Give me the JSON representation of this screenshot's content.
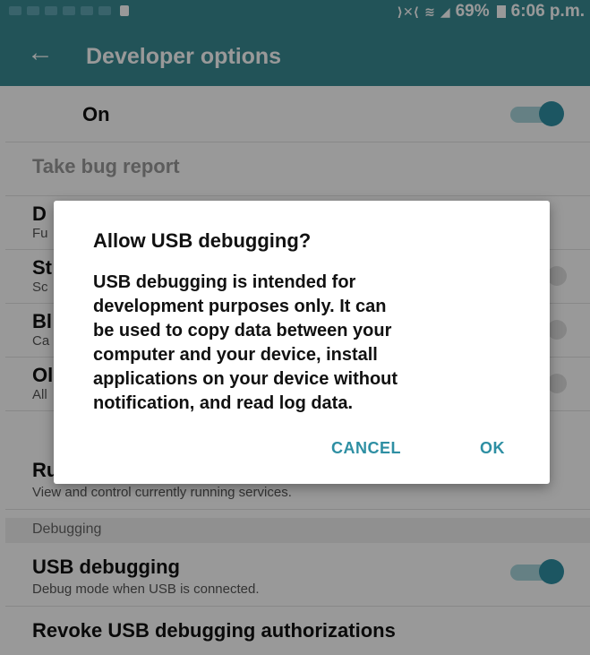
{
  "status_bar": {
    "icons_left": [
      "notification-icons"
    ],
    "icons_right": [
      "nfc-icon",
      "wifi-icon",
      "signal-icon"
    ],
    "battery": "69%",
    "time": "6:06 p.m."
  },
  "app_bar": {
    "back_icon": "arrow-left-icon",
    "title": "Developer options"
  },
  "master_switch": {
    "label": "On",
    "state": "on"
  },
  "rows": [
    {
      "title": "Take bug report",
      "subtitle": ""
    },
    {
      "title": "D",
      "subtitle": "Fu"
    },
    {
      "title": "St",
      "subtitle": "Sc"
    },
    {
      "title": "Bl",
      "subtitle": "Ca"
    },
    {
      "title": "Ol",
      "subtitle": "All"
    },
    {
      "title": "Ru",
      "subtitle": "View and control currently running services."
    }
  ],
  "section": {
    "header": "Debugging"
  },
  "usb_debugging": {
    "title": "USB debugging",
    "subtitle": "Debug mode when USB is connected.",
    "state": "on"
  },
  "revoke": {
    "title": "Revoke USB debugging authorizations"
  },
  "dialog": {
    "title": "Allow USB debugging?",
    "body_lines": [
      "USB debugging is intended for",
      "development purposes only. It can",
      "be used to copy data between your",
      "computer and your device, install",
      "applications on your device without",
      "notification, and read log data."
    ],
    "cancel": "CANCEL",
    "ok": "OK"
  },
  "colors": {
    "accent": "#2f8fa3",
    "appbar": "#3a8a93"
  }
}
